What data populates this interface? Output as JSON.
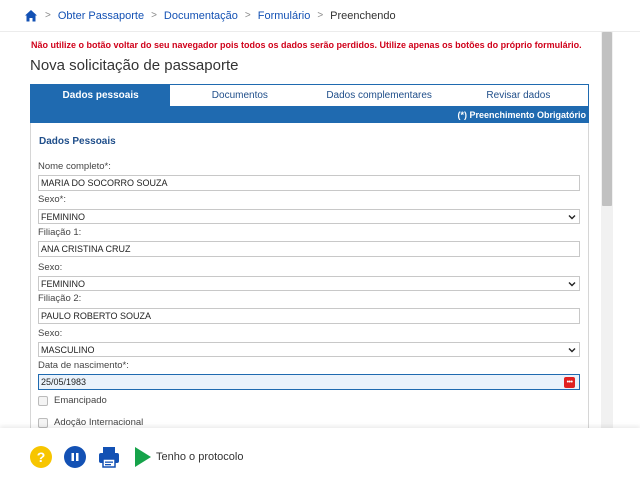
{
  "breadcrumb": {
    "items": [
      "Obter Passaporte",
      "Documentação",
      "Formulário"
    ],
    "current": "Preenchendo",
    "separator": ">"
  },
  "warning": "Não utilize o botão voltar do seu navegador pois todos os dados serão perdidos. Utilize apenas os botões do próprio formulário.",
  "page_title": "Nova solicitação de passaporte",
  "tabs": [
    {
      "label": "Dados pessoais",
      "active": true
    },
    {
      "label": "Documentos",
      "active": false
    },
    {
      "label": "Dados complementares",
      "active": false
    },
    {
      "label": "Revisar dados",
      "active": false
    }
  ],
  "required_note": "(*) Preenchimento Obrigatório",
  "form": {
    "section_title": "Dados Pessoais",
    "nome_label": "Nome completo*:",
    "nome_value": "MARIA DO SOCORRO SOUZA",
    "sexo_label": "Sexo*:",
    "sexo_value": "FEMININO",
    "filiacao1_label": "Filiação 1:",
    "filiacao1_value": "ANA CRISTINA CRUZ",
    "sexo1_label": "Sexo:",
    "sexo1_value": "FEMININO",
    "filiacao2_label": "Filiação 2:",
    "filiacao2_value": "PAULO ROBERTO SOUZA",
    "sexo2_label": "Sexo:",
    "sexo2_value": "MASCULINO",
    "nascimento_label": "Data de nascimento*:",
    "nascimento_value": "25/05/1983",
    "emancipado_label": "Emancipado",
    "adocao_label": "Adoção Internacional"
  },
  "toolbar": {
    "help_glyph": "?",
    "protocol_label": "Tenho o protocolo"
  },
  "colors": {
    "primary": "#1351b4",
    "tab_blue": "#1f6ab0",
    "warning_red": "#d0021b",
    "help_yellow": "#f7c500",
    "play_green": "#16a34a"
  }
}
